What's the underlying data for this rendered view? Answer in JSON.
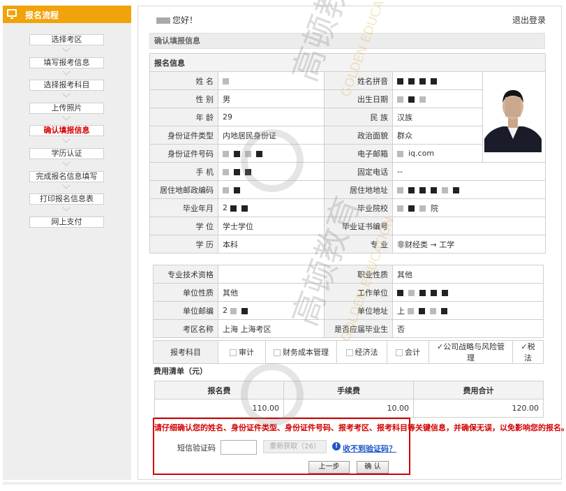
{
  "sidebar": {
    "title": "报名流程",
    "steps": [
      {
        "label": "选择考区"
      },
      {
        "label": "填写报考信息"
      },
      {
        "label": "选择报考科目"
      },
      {
        "label": "上传照片"
      },
      {
        "label": "确认填报信息"
      },
      {
        "label": "学历认证"
      },
      {
        "label": "完成报名信息填写"
      },
      {
        "label": "打印报名信息表"
      },
      {
        "label": "网上支付"
      }
    ],
    "active_step": 4
  },
  "header": {
    "greeting": "您好！",
    "logout": "退出登录"
  },
  "section_title": "确认填报信息",
  "info": {
    "heading": "报名信息",
    "name_label": "姓  名",
    "pinyin_label": "姓名拼音",
    "gender_label": "性  别",
    "gender": "男",
    "birth_label": "出生日期",
    "age_label": "年  龄",
    "age": "29",
    "ethnicity_label": "民  族",
    "ethnicity": "汉族",
    "idtype_label": "身份证件类型",
    "idtype": "内地居民身份证",
    "political_label": "政治面貌",
    "political": "群众",
    "idno_label": "身份证件号码",
    "email_label": "电子邮箱",
    "email_suffix": "iq.com",
    "mobile_label": "手  机",
    "phone_label": "固定电话",
    "phone": "--",
    "postcode_label": "居住地邮政编码",
    "address_label": "居住地地址",
    "gradyear_label": "毕业年月",
    "gradyear_prefix": "2",
    "school_label": "毕业院校",
    "school_suffix": "院",
    "degree_label": "学  位",
    "degree": "学士学位",
    "certno_label": "毕业证书编号",
    "education_label": "学  历",
    "education": "本科",
    "major_label": "专  业",
    "major": "非财经类 → 工学",
    "techqual_label": "专业技术资格",
    "jobnature_label": "职业性质",
    "jobnature": "其他",
    "unitnature_label": "单位性质",
    "unitnature": "其他",
    "employer_label": "工作单位",
    "unitpost_label": "单位邮编",
    "unitpost_prefix": "2",
    "unitaddr_label": "单位地址",
    "unitaddr_prefix": "上",
    "region_label": "考区名称",
    "region": "上海 上海考区",
    "freshgrad_label": "是否应届毕业生",
    "freshgrad": "否",
    "subjects_label": "报考科目",
    "subjects": [
      {
        "name": "审计",
        "checked": false
      },
      {
        "name": "财务成本管理",
        "checked": false
      },
      {
        "name": "经济法",
        "checked": false
      },
      {
        "name": "会计",
        "checked": false
      },
      {
        "name": "公司战略与风险管理",
        "checked": true
      },
      {
        "name": "税法",
        "checked": true
      }
    ]
  },
  "fees": {
    "heading": "费用清单（元）",
    "headers": [
      "报名费",
      "手续费",
      "费用合计"
    ],
    "values": [
      "110.00",
      "10.00",
      "120.00"
    ]
  },
  "confirm": {
    "notice": "请仔细确认您的姓名、身份证件类型、身份证件号码、报考考区、报考科目等关键信息，并确保无误，以免影响您的报名。",
    "sms_label": "短信验证码",
    "sms_value": "",
    "resend_label": "重新获取（26）",
    "help_link": "收不到验证码？",
    "prev_label": "上一步",
    "confirm_label": "确  认"
  },
  "watermark": {
    "cn": "高顿教育",
    "en": "GOLDEN EDUCATION"
  }
}
